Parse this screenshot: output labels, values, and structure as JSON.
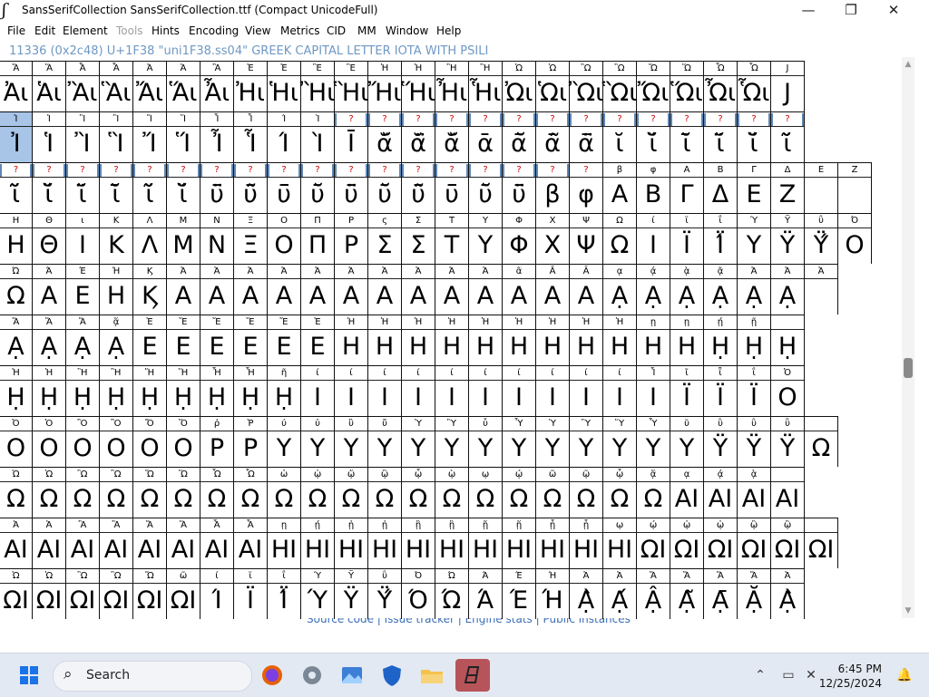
{
  "window": {
    "title": "SansSerifCollection  SansSerifCollection.ttf (Compact UnicodeFull)",
    "minimize": "—",
    "maximize": "❐",
    "close": "✕"
  },
  "menu": [
    "File",
    "Edit",
    "Element",
    "Tools",
    "Hints",
    "Encoding",
    "View",
    "Metrics",
    "CID",
    "MM",
    "Window",
    "Help"
  ],
  "glyph_info": "11336 (0x2c48) U+1F38 \"uni1F38.ss04\" GREEK CAPITAL LETTER IOTA WITH PSILI",
  "grid": {
    "rows": [
      {
        "labels": [
          "Ἄ",
          "Ἅ",
          "Ἆ",
          "Ἇ",
          "Ἀ",
          "Ἁ",
          "Ἂ",
          "Ἐ",
          "Ἑ",
          "Ἒ",
          "Ἓ",
          "Ἠ",
          "Ἡ",
          "Ἢ",
          "Ἣ",
          "Ὠ",
          "Ὡ",
          "Ὢ",
          "Ὣ",
          "Ὤ",
          "Ὥ",
          "Ὦ",
          "Ὧ",
          "J"
        ],
        "glyphs": [
          "Ἀι",
          "Ἁι",
          "Ἂι",
          "Ἃι",
          "Ἄι",
          "Ἅι",
          "Ἆι",
          "Ἠι",
          "Ἡι",
          "Ἢι",
          "Ἣι",
          "Ἤι",
          "Ἥι",
          "Ἦι",
          "Ἧι",
          "Ὠι",
          "Ὡι",
          "Ὢι",
          "Ὣι",
          "Ὤι",
          "Ὥι",
          "Ὦι",
          "Ὧι",
          "J"
        ]
      },
      {
        "labels": [
          "Ἰ",
          "Ἱ",
          "Ἲ",
          "Ἳ",
          "Ἴ",
          "Ἵ",
          "Ἶ",
          "Ἷ",
          "Ί",
          "Ὶ",
          "?",
          "?",
          "?",
          "?",
          "?",
          "?",
          "?",
          "?",
          "?",
          "?",
          "?",
          "?",
          "?",
          "?"
        ],
        "glyphs": [
          "Ἰ",
          "Ἱ",
          "Ἲ",
          "Ἳ",
          "Ἴ",
          "Ἵ",
          "Ἶ",
          "Ἷ",
          "Ί",
          "Ὶ",
          "Ῑ",
          "ᾰ̆",
          "ᾰ̈",
          "ᾰ̆",
          "ᾱ",
          "ᾱ̆",
          "ᾱ̃",
          "ᾱ̈",
          "ῐ",
          "ῐ̆",
          "ῐ̄",
          "ῐ̈",
          "ῐ̆",
          "ῐ̃"
        ]
      },
      {
        "labels": [
          "?",
          "?",
          "?",
          "?",
          "?",
          "?",
          "?",
          "?",
          "?",
          "?",
          "?",
          "?",
          "?",
          "?",
          "?",
          "?",
          "?",
          "?",
          "β",
          "φ",
          "Α",
          "Β",
          "Γ",
          "Δ",
          "Ε",
          "Ζ"
        ],
        "glyphs": [
          "ῐ̃",
          "ῐ̆",
          "ῐ̈",
          "ῐ̄",
          "ῐ̃",
          "ῐ̆",
          "ῡ̈",
          "ῡ̃",
          "ῡ̄",
          "ῡ̆",
          "ῡ̈",
          "ῡ̆",
          "ῡ̃",
          "ῡ̄",
          "ῡ̆",
          "ῡ̈",
          "β",
          "φ",
          "Α",
          "Β",
          "Γ",
          "Δ",
          "Ε",
          "Ζ"
        ]
      },
      {
        "labels": [
          "Η",
          "Θ",
          "ι",
          "Κ",
          "Λ",
          "Μ",
          "Ν",
          "Ξ",
          "Ο",
          "Π",
          "Ρ",
          "ς",
          "Σ",
          "Τ",
          "Υ",
          "Φ",
          "Χ",
          "Ψ",
          "Ω",
          "ί",
          "ϊ",
          "ΐ",
          "Ύ",
          "Ϋ",
          "ΰ",
          "Ό"
        ],
        "glyphs": [
          "Η",
          "Θ",
          "Ι",
          "Κ",
          "Λ",
          "Μ",
          "Ν",
          "Ξ",
          "Ο",
          "Π",
          "Ρ",
          "Σ",
          "Σ",
          "Τ",
          "Υ",
          "Φ",
          "Χ",
          "Ψ",
          "Ω",
          "Ι",
          "Ϊ",
          "Ϊ́",
          "Υ",
          "Ϋ",
          "Ϋ́",
          "Ο"
        ]
      },
      {
        "labels": [
          "Ώ",
          "Ά",
          "Έ",
          "Ή",
          "Ϗ",
          "Ἀ",
          "Ἀ",
          "Ἀ",
          "Ἀ",
          "Ἀ",
          "Ἀ",
          "Ἀ",
          "Ἀ",
          "Ἀ",
          "Ἀ",
          "ᾶ",
          "Ᾰ",
          "Ᾱ",
          "ᾳ",
          "ᾴ",
          "ᾲ",
          "ᾷ",
          "Ἀ",
          "Ἀ",
          "Ἀ"
        ],
        "glyphs": [
          "Ω",
          "Α",
          "Ε",
          "Η",
          "Ϗ",
          "Α",
          "Α",
          "Α",
          "Α",
          "Α",
          "Α",
          "Α",
          "Α",
          "Α",
          "Α",
          "Α",
          "Α",
          "Α",
          "Ạ",
          "Ạ",
          "Ạ",
          "Ạ",
          "Ạ",
          "Ạ"
        ]
      },
      {
        "labels": [
          "Ἄ",
          "Ἄ",
          "Ἄ",
          "ᾅ",
          "Ἐ",
          "Ἔ",
          "Ἔ",
          "Ἔ",
          "Ἔ",
          "Ἐ",
          "Ἠ",
          "Ἠ",
          "Ἠ",
          "Ἠ",
          "Ἠ",
          "Ἠ",
          "Ἠ",
          "Ἠ",
          "Ἠ",
          "ῃ",
          "ῃ",
          "ῄ",
          "ῇ"
        ],
        "glyphs": [
          "Ạ",
          "Ạ",
          "Ạ",
          "Ạ",
          "Ε",
          "Ε",
          "Ε",
          "Ε",
          "Ε",
          "Ε",
          "Η",
          "Η",
          "Η",
          "Η",
          "Η",
          "Η",
          "Η",
          "Η",
          "Η",
          "Η",
          "Η",
          "Ḥ",
          "Ḥ",
          "Ḥ"
        ]
      },
      {
        "labels": [
          "Ἠ",
          "Ἡ",
          "Ἢ",
          "Ἣ",
          "Ἤ",
          "Ἥ",
          "Ἦ",
          "Ἧ",
          "ῆ",
          "ί",
          "ί",
          "ί",
          "ί",
          "ί",
          "ί",
          "ί",
          "ί",
          "ί",
          "ί",
          "Ἶ",
          "ῖ",
          "ῗ",
          "ΐ",
          "Ὀ"
        ],
        "glyphs": [
          "Ḥ",
          "Ḥ",
          "Ḥ",
          "Ḥ",
          "Ḥ",
          "Ḥ",
          "Ḥ",
          "Ḥ",
          "Ḥ",
          "Ι",
          "Ι",
          "Ι",
          "Ι",
          "Ι",
          "Ι",
          "Ι",
          "Ι",
          "Ι",
          "Ι",
          "Ι",
          "Ϊ",
          "Ϊ",
          "Ϊ",
          "Ο"
        ]
      },
      {
        "labels": [
          "Ὀ",
          "Ὁ",
          "Ὂ",
          "Ὃ",
          "Ὄ",
          "Ὅ",
          "ῤ",
          "Ῥ",
          "ύ",
          "ὐ",
          "ὒ",
          "ὔ",
          "Ὑ",
          "Ὓ",
          "ὖ",
          "Ὗ",
          "Ὑ",
          "Ὓ",
          "Ὕ",
          "Ὗ",
          "ῠ",
          "ῢ",
          "ΰ",
          "ῧ"
        ],
        "glyphs": [
          "Ο",
          "Ο",
          "Ο",
          "Ο",
          "Ο",
          "Ο",
          "Ρ",
          "Ρ",
          "Υ",
          "Υ",
          "Υ",
          "Υ",
          "Υ",
          "Υ",
          "Υ",
          "Υ",
          "Υ",
          "Υ",
          "Υ",
          "Υ",
          "Υ",
          "Ϋ",
          "Ϋ",
          "Ϋ",
          "Ω"
        ]
      },
      {
        "labels": [
          "Ὠ",
          "Ὡ",
          "Ὢ",
          "Ὣ",
          "Ὤ",
          "Ὥ",
          "Ὦ",
          "Ὧ",
          "ὠ",
          "ᾠ",
          "ᾤ",
          "ᾢ",
          "ᾦ",
          "ῲ",
          "ῳ",
          "ῴ",
          "ῶ",
          "ῷ",
          "ᾧ",
          "ᾅ",
          "ᾳ",
          "ᾴ",
          "ᾲ"
        ],
        "glyphs": [
          "Ω",
          "Ω",
          "Ω",
          "Ω",
          "Ω",
          "Ω",
          "Ω",
          "Ω",
          "Ω",
          "Ω",
          "Ω",
          "Ω",
          "Ω",
          "Ω",
          "Ω",
          "Ω",
          "Ω",
          "Ω",
          "Ω",
          "Ω",
          "ΑΙ",
          "ΑΙ",
          "ΑΙ",
          "ΑΙ"
        ]
      },
      {
        "labels": [
          "Ἀ",
          "Ἁ",
          "Ἂ",
          "Ἃ",
          "Ἄ",
          "Ἅ",
          "Ἆ",
          "Ἇ",
          "ῃ",
          "ῄ",
          "ᾐ",
          "ᾑ",
          "ᾒ",
          "ᾓ",
          "ᾔ",
          "ᾕ",
          "ᾖ",
          "ᾗ",
          "ῳ",
          "ῴ",
          "ᾠ",
          "ᾡ",
          "ᾢ",
          "ᾣ"
        ],
        "glyphs": [
          "ΑΙ",
          "ΑΙ",
          "ΑΙ",
          "ΑΙ",
          "ΑΙ",
          "ΑΙ",
          "ΑΙ",
          "ΑΙ",
          "ΗΙ",
          "ΗΙ",
          "ΗΙ",
          "ΗΙ",
          "ΗΙ",
          "ΗΙ",
          "ΗΙ",
          "ΗΙ",
          "ΗΙ",
          "ΗΙ",
          "ΗΙ",
          "ΩΙ",
          "ΩΙ",
          "ΩΙ",
          "ΩΙ",
          "ΩΙ",
          "ΩΙ"
        ]
      },
      {
        "labels": [
          "Ὠ",
          "Ὡ",
          "Ὢ",
          "Ὣ",
          "Ὤ",
          "ῶ",
          "ί",
          "ϊ",
          "ΐ",
          "Ύ",
          "Ϋ",
          "ΰ",
          "Ό",
          "Ώ",
          "Ά",
          "Έ",
          "Ή",
          "Ἀ",
          "Ἀ",
          "Ἄ",
          "Ἄ",
          "Ἄ",
          "Ἄ",
          "Ἀ"
        ],
        "glyphs": [
          "ΩΙ",
          "ΩΙ",
          "ΩΙ",
          "ΩΙ",
          "ΩΙ",
          "ΩΙ",
          "Ί",
          "Ϊ",
          "Ϊ́",
          "Ύ",
          "Ϋ",
          "Ϋ́",
          "Ό",
          "Ώ",
          "Ά",
          "Έ",
          "Ή",
          "Ạ̀",
          "Ạ́",
          "Ậ",
          "Ạ̃",
          "Ạ̄",
          "Ặ",
          "Ạ̀"
        ]
      }
    ]
  },
  "background_links": "Source code | Issue tracker | Engine stats | Public instances",
  "taskbar": {
    "search_label": "Search",
    "time": "6:45 PM",
    "date": "12/25/2024"
  },
  "colors": {
    "selection": "#a8c4e6",
    "marker": "#5f86b5",
    "missing_label": "#d00000",
    "info_text": "#6f98c4"
  }
}
